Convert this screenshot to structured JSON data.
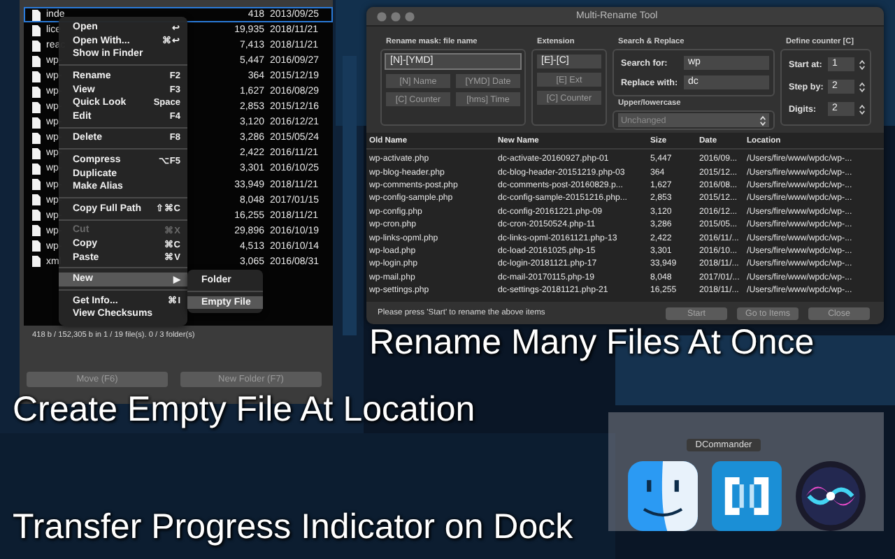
{
  "file_panel": {
    "rows": [
      {
        "name": "inde",
        "size": "418",
        "date": "2013/09/25",
        "selected": true
      },
      {
        "name": "lice",
        "size": "19,935",
        "date": "2018/11/21",
        "selected": false
      },
      {
        "name": "reac",
        "size": "7,413",
        "date": "2018/11/21",
        "selected": false
      },
      {
        "name": "wp-",
        "size": "5,447",
        "date": "2016/09/27",
        "selected": false
      },
      {
        "name": "wp-",
        "size": "364",
        "date": "2015/12/19",
        "selected": false
      },
      {
        "name": "wp-",
        "size": "1,627",
        "date": "2016/08/29",
        "selected": false
      },
      {
        "name": "wp-",
        "size": "2,853",
        "date": "2015/12/16",
        "selected": false
      },
      {
        "name": "wp-",
        "size": "3,120",
        "date": "2016/12/21",
        "selected": false
      },
      {
        "name": "wp-",
        "size": "3,286",
        "date": "2015/05/24",
        "selected": false
      },
      {
        "name": "wp-",
        "size": "2,422",
        "date": "2016/11/21",
        "selected": false
      },
      {
        "name": "wp-",
        "size": "3,301",
        "date": "2016/10/25",
        "selected": false
      },
      {
        "name": "wp-",
        "size": "33,949",
        "date": "2018/11/21",
        "selected": false
      },
      {
        "name": "wp-",
        "size": "8,048",
        "date": "2017/01/15",
        "selected": false
      },
      {
        "name": "wp-",
        "size": "16,255",
        "date": "2018/11/21",
        "selected": false
      },
      {
        "name": "wp-",
        "size": "29,896",
        "date": "2016/10/19",
        "selected": false
      },
      {
        "name": "wp-",
        "size": "4,513",
        "date": "2016/10/14",
        "selected": false
      },
      {
        "name": "xml",
        "size": "3,065",
        "date": "2016/08/31",
        "selected": false
      }
    ],
    "status": "418 b / 152,305 b in 1 / 19 file(s).  0 / 3 folder(s)",
    "buttons": [
      "Move (F6)",
      "New Folder (F7)"
    ]
  },
  "context_menu": {
    "items": [
      {
        "kind": "item",
        "label": "Open",
        "shortcut": "↩",
        "disabled": false,
        "selected": false
      },
      {
        "kind": "item",
        "label": "Open With...",
        "shortcut": "⌘↩",
        "disabled": false,
        "selected": false
      },
      {
        "kind": "item",
        "label": "Show in Finder",
        "disabled": false,
        "selected": false
      },
      {
        "kind": "separator"
      },
      {
        "kind": "item",
        "label": "Rename",
        "shortcut": "F2",
        "disabled": false,
        "selected": false
      },
      {
        "kind": "item",
        "label": "View",
        "shortcut": "F3",
        "disabled": false,
        "selected": false
      },
      {
        "kind": "item",
        "label": "Quick Look",
        "shortcut": "Space",
        "disabled": false,
        "selected": false
      },
      {
        "kind": "item",
        "label": "Edit",
        "shortcut": "F4",
        "disabled": false,
        "selected": false
      },
      {
        "kind": "separator"
      },
      {
        "kind": "item",
        "label": "Delete",
        "shortcut": "F8",
        "disabled": false,
        "selected": false
      },
      {
        "kind": "separator"
      },
      {
        "kind": "item",
        "label": "Compress",
        "shortcut": "⌥F5",
        "disabled": false,
        "selected": false
      },
      {
        "kind": "item",
        "label": "Duplicate",
        "disabled": false,
        "selected": false
      },
      {
        "kind": "item",
        "label": "Make Alias",
        "disabled": false,
        "selected": false
      },
      {
        "kind": "separator"
      },
      {
        "kind": "item",
        "label": "Copy Full Path",
        "shortcut": "⇧⌘C",
        "disabled": false,
        "selected": false
      },
      {
        "kind": "separator"
      },
      {
        "kind": "item",
        "label": "Cut",
        "shortcut": "⌘X",
        "disabled": true,
        "selected": false
      },
      {
        "kind": "item",
        "label": "Copy",
        "shortcut": "⌘C",
        "disabled": false,
        "selected": false
      },
      {
        "kind": "item",
        "label": "Paste",
        "shortcut": "⌘V",
        "disabled": false,
        "selected": false
      },
      {
        "kind": "separator"
      },
      {
        "kind": "item",
        "label": "New",
        "shortcut": "▶",
        "disabled": false,
        "selected": true
      },
      {
        "kind": "separator"
      },
      {
        "kind": "item",
        "label": "Get Info...",
        "shortcut": "⌘I",
        "disabled": false,
        "selected": false
      },
      {
        "kind": "item",
        "label": "View Checksums",
        "disabled": false,
        "selected": false
      }
    ]
  },
  "submenu": {
    "items": [
      {
        "kind": "item",
        "label": "Folder",
        "selected": false
      },
      {
        "kind": "separator"
      },
      {
        "kind": "item",
        "label": "Empty File",
        "selected": true
      }
    ]
  },
  "rename_window": {
    "title": "Multi-Rename Tool",
    "mask": {
      "label": "Rename mask: file name",
      "value": "[N]-[YMD]",
      "buttons": [
        "[N] Name",
        "[YMD] Date",
        "[C] Counter",
        "[hms] Time"
      ]
    },
    "extension": {
      "label": "Extension",
      "value": "[E]-[C]",
      "buttons": [
        "[E] Ext",
        "[C] Counter"
      ]
    },
    "search_replace": {
      "label": "Search & Replace",
      "fields": [
        {
          "label": "Search for:",
          "value": "wp"
        },
        {
          "label": "Replace with:",
          "value": "dc"
        }
      ]
    },
    "case": {
      "label": "Upper/lowercase",
      "value": "Unchanged",
      "disabled": true
    },
    "counter": {
      "label": "Define counter [C]",
      "fields": [
        {
          "label": "Start at:",
          "value": "1"
        },
        {
          "label": "Step by:",
          "value": "2"
        },
        {
          "label": "Digits:",
          "value": "2"
        }
      ]
    },
    "table": {
      "columns": [
        "Old Name",
        "New Name",
        "Size",
        "Date",
        "Location"
      ],
      "rows": [
        [
          "wp-activate.php",
          "dc-activate-20160927.php-01",
          "5,447",
          "2016/09...",
          "/Users/fire/www/wpdc/wp-..."
        ],
        [
          "wp-blog-header.php",
          "dc-blog-header-20151219.php-03",
          "364",
          "2015/12...",
          "/Users/fire/www/wpdc/wp-..."
        ],
        [
          "wp-comments-post.php",
          "dc-comments-post-20160829.p...",
          "1,627",
          "2016/08...",
          "/Users/fire/www/wpdc/wp-..."
        ],
        [
          "wp-config-sample.php",
          "dc-config-sample-20151216.php...",
          "2,853",
          "2015/12...",
          "/Users/fire/www/wpdc/wp-..."
        ],
        [
          "wp-config.php",
          "dc-config-20161221.php-09",
          "3,120",
          "2016/12...",
          "/Users/fire/www/wpdc/wp-..."
        ],
        [
          "wp-cron.php",
          "dc-cron-20150524.php-11",
          "3,286",
          "2015/05...",
          "/Users/fire/www/wpdc/wp-..."
        ],
        [
          "wp-links-opml.php",
          "dc-links-opml-20161121.php-13",
          "2,422",
          "2016/11/...",
          "/Users/fire/www/wpdc/wp-..."
        ],
        [
          "wp-load.php",
          "dc-load-20161025.php-15",
          "3,301",
          "2016/10...",
          "/Users/fire/www/wpdc/wp-..."
        ],
        [
          "wp-login.php",
          "dc-login-20181121.php-17",
          "33,949",
          "2018/11/...",
          "/Users/fire/www/wpdc/wp-..."
        ],
        [
          "wp-mail.php",
          "dc-mail-20170115.php-19",
          "8,048",
          "2017/01/...",
          "/Users/fire/www/wpdc/wp-..."
        ],
        [
          "wp-settings.php",
          "dc-settings-20181121.php-21",
          "16,255",
          "2018/11/...",
          "/Users/fire/www/wpdc/wp-..."
        ]
      ]
    },
    "status": "Please press 'Start' to rename the above items",
    "buttons": [
      "Start",
      "Go to Items",
      "Close"
    ]
  },
  "captions": [
    "Rename Many Files At Once",
    "Create Empty File At Location",
    "Transfer Progress Indicator on Dock"
  ],
  "dock": {
    "tooltip": "DCommander",
    "icons": [
      {
        "kind": "finder"
      },
      {
        "kind": "dcommander"
      },
      {
        "kind": "siri"
      }
    ]
  }
}
